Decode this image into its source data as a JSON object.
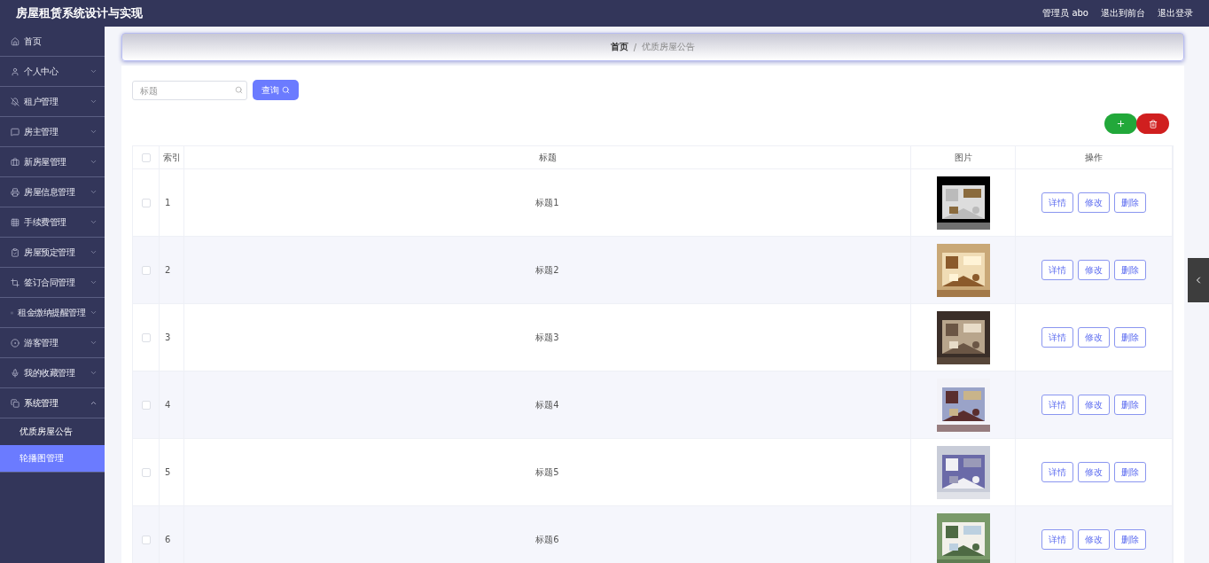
{
  "header": {
    "title": "房屋租赁系统设计与实现",
    "user": "管理员 abo",
    "links": [
      "退出到前台",
      "退出登录"
    ]
  },
  "sidebar": {
    "items": [
      {
        "label": "首页",
        "kind": "link"
      },
      {
        "label": "个人中心",
        "kind": "menu",
        "expanded": false
      },
      {
        "label": "租户管理",
        "kind": "menu",
        "expanded": false
      },
      {
        "label": "房主管理",
        "kind": "menu",
        "expanded": false
      },
      {
        "label": "新房屋管理",
        "kind": "menu",
        "expanded": false
      },
      {
        "label": "房屋信息管理",
        "kind": "menu",
        "expanded": false
      },
      {
        "label": "手续费管理",
        "kind": "menu",
        "expanded": false
      },
      {
        "label": "房屋预定管理",
        "kind": "menu",
        "expanded": false
      },
      {
        "label": "签订合同管理",
        "kind": "menu",
        "expanded": false
      },
      {
        "label": "租金缴纳提醒管理",
        "kind": "menu",
        "expanded": false
      },
      {
        "label": "游客管理",
        "kind": "menu",
        "expanded": false
      },
      {
        "label": "我的收藏管理",
        "kind": "menu",
        "expanded": false
      },
      {
        "label": "系统管理",
        "kind": "menu",
        "expanded": true,
        "children": [
          {
            "label": "优质房屋公告",
            "selected": false
          },
          {
            "label": "轮播图管理",
            "selected": true
          }
        ]
      }
    ]
  },
  "breadcrumb": {
    "items": [
      "首页",
      "优质房屋公告"
    ],
    "separator": "/"
  },
  "search": {
    "placeholder": "标题",
    "button": "查询"
  },
  "table": {
    "select_all_checked": false,
    "columns": [
      "索引",
      "标题",
      "图片",
      "操作"
    ],
    "rows": [
      {
        "index": "1",
        "title": "标题1",
        "checked": false,
        "actions": [
          "详情",
          "修改",
          "删除"
        ]
      },
      {
        "index": "2",
        "title": "标题2",
        "checked": false,
        "actions": [
          "详情",
          "修改",
          "删除"
        ]
      },
      {
        "index": "3",
        "title": "标题3",
        "checked": false,
        "actions": [
          "详情",
          "修改",
          "删除"
        ]
      },
      {
        "index": "4",
        "title": "标题4",
        "checked": false,
        "actions": [
          "详情",
          "修改",
          "删除"
        ]
      },
      {
        "index": "5",
        "title": "标题5",
        "checked": false,
        "actions": [
          "详情",
          "修改",
          "删除"
        ]
      },
      {
        "index": "6",
        "title": "标题6",
        "checked": false,
        "actions": [
          "详情",
          "修改",
          "删除"
        ]
      }
    ]
  }
}
